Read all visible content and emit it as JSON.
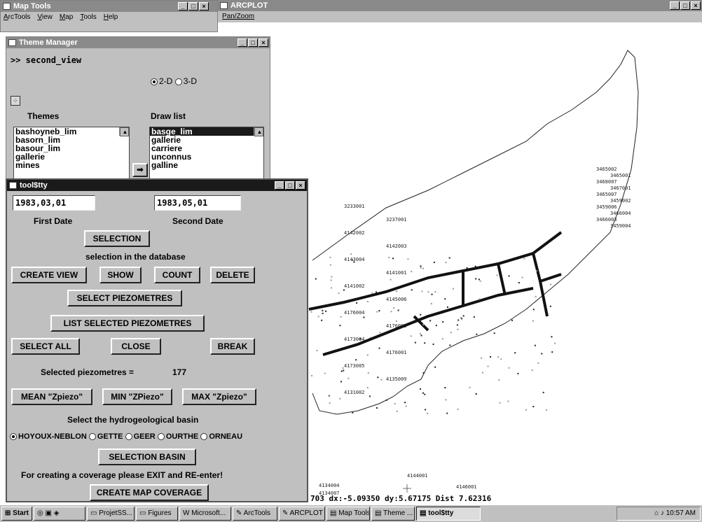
{
  "map_tools": {
    "title": "Map Tools",
    "menu": [
      "ArcTools",
      "View",
      "Map",
      "Tools",
      "Help"
    ]
  },
  "arcplot": {
    "title": "ARCPLOT",
    "menu": [
      "Pan/Zoom"
    ],
    "status_line": "703 dx:-5.09350 dy:5.67175 Dist 7.62316",
    "map_labels": {
      "top_right": [
        "3465002",
        "3465001",
        "3468007",
        "3467001",
        "3465007",
        "3459002",
        "3459006",
        "3466004",
        "3466003",
        "3459004"
      ],
      "bottom": [
        "4134004",
        "4134007",
        "4144001",
        "4146001"
      ],
      "middle": [
        "3233001",
        "3237001",
        "4142002",
        "4142003",
        "4143004",
        "4141001",
        "4141002",
        "4145006",
        "4176004",
        "4176005",
        "4173004",
        "4176001",
        "4173005",
        "4135009",
        "4131002"
      ]
    }
  },
  "theme_manager": {
    "title": "Theme Manager",
    "view_name": ">> second_view",
    "mode_options": [
      "2-D",
      "3-D"
    ],
    "mode_selected": "2-D",
    "themes_label": "Themes",
    "drawlist_label": "Draw list",
    "themes": [
      "bashoyneb_lim",
      "basorn_lim",
      "basour_lim",
      "gallerie",
      "mines"
    ],
    "drawlist": [
      "basge_lim",
      "gallerie",
      "carriere",
      "unconnus",
      "galline"
    ],
    "drawlist_selected": "basge_lim"
  },
  "toolsty": {
    "title": "tool$tty",
    "first_date_value": "1983,03,01",
    "second_date_value": "1983,05,01",
    "first_date_label": "First Date",
    "second_date_label": "Second Date",
    "selection_button": "SELECTION",
    "selection_db_text": "selection in the database",
    "create_view": "CREATE VIEW",
    "show": "SHOW",
    "count": "COUNT",
    "delete": "DELETE",
    "select_piezometres": "SELECT PIEZOMETRES",
    "list_selected": "LIST SELECTED PIEZOMETRES",
    "select_all": "SELECT ALL",
    "close": "CLOSE",
    "break": "BREAK",
    "selected_label": "Selected piezometres =",
    "selected_count": "177",
    "mean": "MEAN \"Zpiezo\"",
    "min": "MIN \"ZPiezo\"",
    "max": "MAX \"Zpiezo\"",
    "basin_prompt": "Select the hydrogeological basin",
    "basins": [
      "HOYOUX-NEBLON",
      "GETTE",
      "GEER",
      "OURTHE",
      "ORNEAU"
    ],
    "basin_selected": "HOYOUX-NEBLON",
    "selection_basin": "SELECTION  BASIN",
    "coverage_note": "For creating a coverage please EXIT and RE-enter!",
    "create_map_coverage": "CREATE MAP COVERAGE"
  },
  "taskbar": {
    "start": "Start",
    "tasks": [
      "ProjetSS...",
      "Figures",
      "Microsoft...",
      "ArcTools",
      "ARCPLOT",
      "Map Tools",
      "Theme ...",
      "tool$tty"
    ],
    "active_task": "tool$tty",
    "clock": "10:57 AM"
  }
}
